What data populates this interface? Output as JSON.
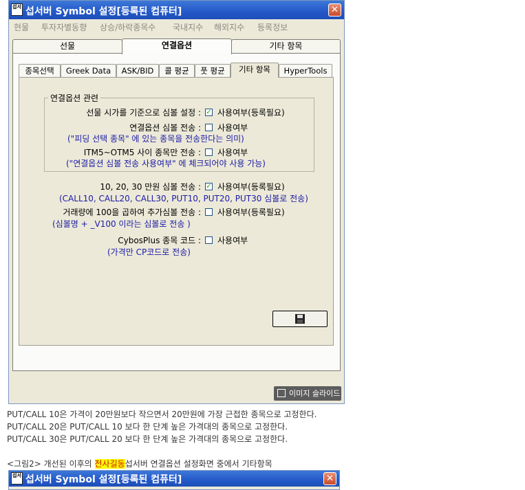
{
  "window": {
    "title": "섭서버 Symbol 설정[등록된 컴퓨터]",
    "icon_text": "섭서",
    "close_glyph": "✕"
  },
  "menu": [
    "현물",
    "투자자별동향",
    "상승/하락종목수",
    "국내지수",
    "해외지수",
    "등록정보"
  ],
  "outer_tabs": [
    "선물",
    "연결옵션",
    "기타 항목"
  ],
  "inner_tabs": [
    "종목선택",
    "Greek Data",
    "ASK/BID",
    "콜 평균",
    "풋 평균",
    "기타 항목",
    "HyperTools"
  ],
  "group": {
    "title": "연결옵션 관련",
    "rows": [
      {
        "label": "선물 시가를 기준으로 심볼 설정 :",
        "checked": true,
        "option": "사용여부(등록필요)",
        "note": ""
      },
      {
        "label": "연결옵션 심볼 전송 :",
        "checked": false,
        "option": "사용여부",
        "note": "(\"피딩 선택 종목\" 에 있는 종목을 전송한다는 의미)"
      },
      {
        "label": "ITM5~OTM5 사이 종목만 전송 :",
        "checked": false,
        "option": "사용여부",
        "note": "(\"연결옵션 심볼 전송 사용여부\" 에 체크되어야 사용 가능)"
      }
    ]
  },
  "rows": [
    {
      "label": "10, 20, 30 만원 심볼 전송 :",
      "checked": true,
      "option": "사용여부(등록필요)",
      "note": "(CALL10, CALL20, CALL30, PUT10, PUT20, PUT30 심볼로 전송)"
    },
    {
      "label": "거래량에 100을 곱하여 추가심볼 전송 :",
      "checked": false,
      "option": "사용여부(등록필요)",
      "note": "(심볼명 + _V100 이라는 심볼로 전송 )"
    },
    {
      "label": "CybosPlus 종목 코드 :",
      "checked": false,
      "option": "사용여부",
      "note": "(가격만 CP코드로 전송)"
    }
  ],
  "check_glyph": "✓",
  "slide_button": "이미지 슬라이드",
  "paragraphs": [
    "PUT/CALL 10은 가격이 20만원보다 작으면서 20만원에 가장 근접한 종목으로 고정한다.",
    "PUT/CALL 20은 PUT/CALL 10 보다 한 단계 높은 가격대의 종목으로 고정한다.",
    "PUT/CALL 30은 PUT/CALL 20 보다 한 단계 높은 가격대의 종목으로 고정한다."
  ],
  "caption": {
    "prefix": "<그림2> 개선된 이후의 ",
    "highlight": "전사길동",
    "suffix": "섭서버 연결옵션 설정화면 중에서 기타항목"
  },
  "window2": {
    "title": "섭서버 Symbol 설정[등록된 컴퓨터]",
    "icon_text": "섭서",
    "close_glyph": "✕"
  }
}
